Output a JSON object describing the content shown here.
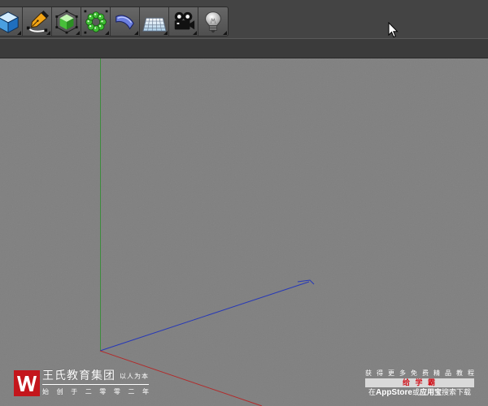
{
  "toolbar": {
    "buttons": [
      {
        "icon": "cube-icon",
        "color": "#3f93d8"
      },
      {
        "icon": "pen-spline-icon",
        "color": "#f2a516"
      },
      {
        "icon": "subdivision-cube-icon",
        "color": "#48c03a"
      },
      {
        "icon": "cloner-icon",
        "color": "#3fbf33"
      },
      {
        "icon": "bend-deformer-icon",
        "color": "#6b7fe0"
      },
      {
        "icon": "floor-grid-icon",
        "color": "#d7ecfb"
      },
      {
        "icon": "camera-icon",
        "color": "#111111"
      },
      {
        "icon": "light-bulb-icon",
        "color": "#e6e6e6"
      }
    ]
  },
  "cursor": {
    "icon": "arrow-cursor-icon"
  },
  "viewport": {
    "background": "#808080",
    "axes": {
      "x_color": "#b32a2a",
      "y_color": "#3d8c3d",
      "z_color": "#2638b8"
    }
  },
  "watermark_left": {
    "logo_icon": "wangshi-logo-icon",
    "logo_color": "#c4161c",
    "brand": "王氏教育集团",
    "motto": "以人为本",
    "founded": "始 创 于 二 零 零 二 年"
  },
  "watermark_right": {
    "promo": "获 得 更 多 免 费 精 品 教 程",
    "app_name": "给 学 霸",
    "app_color": "#d0121b",
    "download": {
      "prefix": "在",
      "store1": "AppStore",
      "conj": "或",
      "store2": "应用宝",
      "suffix": "搜索下载"
    }
  }
}
